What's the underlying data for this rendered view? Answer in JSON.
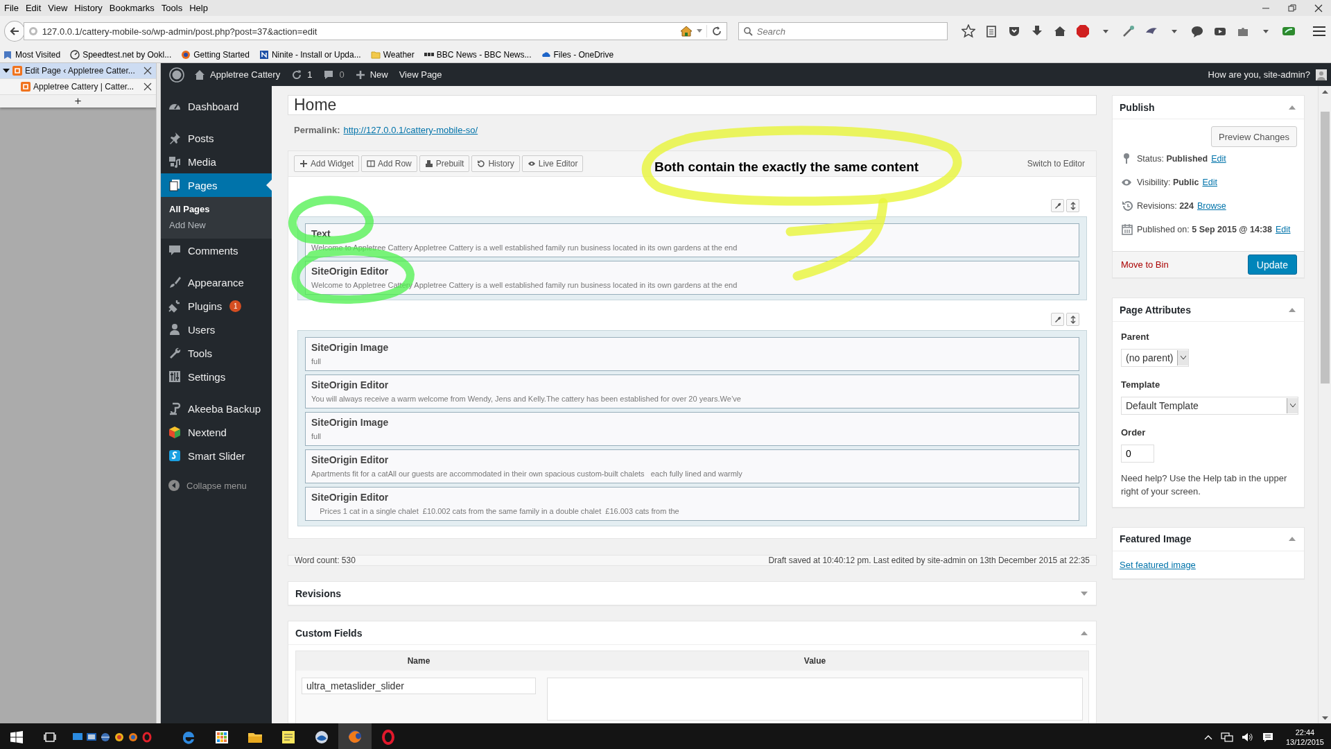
{
  "browser": {
    "menu": [
      "File",
      "Edit",
      "View",
      "History",
      "Bookmarks",
      "Tools",
      "Help"
    ],
    "url": "127.0.0.1/cattery-mobile-so/wp-admin/post.php?post=37&action=edit",
    "search": {
      "placeholder": "Search"
    },
    "bookmarks": [
      "Most Visited",
      "Speedtest.net by Ookl...",
      "Getting Started",
      "Ninite - Install or Upda...",
      "Weather",
      "BBC News - BBC News...",
      "Files - OneDrive"
    ]
  },
  "tab_tree": {
    "tabs": [
      {
        "title": "Edit Page ‹ Appletree Catter...",
        "selected": true,
        "expanded": true,
        "children": [
          {
            "title": "Appletree Cattery | Catter...",
            "selected": false
          }
        ]
      }
    ],
    "new_tab": "+"
  },
  "admin_bar": {
    "site": "Appletree Cattery",
    "updates": "1",
    "comments": "0",
    "new": "New",
    "view": "View Page",
    "greeting": "How are you, site-admin?"
  },
  "sidebar": {
    "groups": [
      [
        {
          "label": "Dashboard",
          "selected": false
        }
      ],
      [
        {
          "label": "Posts",
          "selected": false
        },
        {
          "label": "Media",
          "selected": false
        },
        {
          "label": "Pages",
          "selected": true,
          "children": [
            {
              "label": "All Pages",
              "selected": true
            },
            {
              "label": "Add New",
              "selected": false
            }
          ]
        },
        {
          "label": "Comments",
          "selected": false
        }
      ],
      [
        {
          "label": "Appearance",
          "selected": false
        },
        {
          "label": "Plugins",
          "selected": false,
          "badge": "1"
        },
        {
          "label": "Users",
          "selected": false
        },
        {
          "label": "Tools",
          "selected": false
        },
        {
          "label": "Settings",
          "selected": false
        }
      ],
      [
        {
          "label": "Akeeba Backup",
          "selected": false
        },
        {
          "label": "Nextend",
          "selected": false
        },
        {
          "label": "Smart Slider",
          "selected": false
        }
      ]
    ],
    "collapse": "Collapse menu"
  },
  "editor": {
    "title": "Home",
    "permalink": {
      "label": "Permalink:",
      "url": "http://127.0.0.1/cattery-mobile-so/"
    },
    "builder": {
      "tools": [
        "Add Widget",
        "Add Row",
        "Prebuilt",
        "History",
        "Live Editor"
      ],
      "switch": "Switch to Editor",
      "rows": [
        {
          "widgets": [
            {
              "title": "Text",
              "summary": "Welcome to Appletree Cattery Appletree Cattery is a well established family run business located in its own gardens at the end"
            },
            {
              "title": "SiteOrigin Editor",
              "summary": "Welcome to Appletree Cattery Appletree Cattery is a well established family run business located in its own gardens at the end"
            }
          ]
        },
        {
          "widgets": [
            {
              "title": "SiteOrigin Image",
              "summary": "full"
            },
            {
              "title": "SiteOrigin Editor",
              "summary": "You will always receive a warm welcome from Wendy, Jens and Kelly.The cattery has been established for over 20 years.We’ve"
            },
            {
              "title": "SiteOrigin Image",
              "summary": "full"
            },
            {
              "title": "SiteOrigin Editor",
              "summary": "Apartments fit for a catAll our guests are accommodated in their own spacious custom-built chalets   each fully lined and warmly"
            },
            {
              "title": "SiteOrigin Editor",
              "summary": "    Prices 1 cat in a single chalet  £10.002 cats from the same family in a double chalet  £16.003 cats from the"
            }
          ]
        }
      ]
    },
    "word_count": "Word count: 530",
    "draft_status": "Draft saved at 10:40:12 pm. Last edited by site-admin on 13th December 2015 at 22:35"
  },
  "annotation": {
    "text": "Both contain the exactly the same content"
  },
  "revisions": {
    "title": "Revisions",
    "expanded": false
  },
  "custom_fields": {
    "title": "Custom Fields",
    "expanded": true,
    "columns": [
      "Name",
      "Value"
    ],
    "name": "ultra_metaslider_slider"
  },
  "publish": {
    "title": "Publish",
    "expanded": true,
    "preview": "Preview Changes",
    "rows": [
      {
        "text": "Status: **Published**",
        "link": "Edit"
      },
      {
        "text": "Visibility: **Public**",
        "link": "Edit"
      },
      {
        "text": "Revisions: **224**",
        "link": "Browse"
      },
      {
        "text": "Published on: **5 Sep 2015 @ 14:38**",
        "link": "Edit"
      }
    ],
    "trash": "Move to Bin",
    "update": "Update"
  },
  "page_attributes": {
    "title": "Page Attributes",
    "expanded": true,
    "parent_label": "Parent",
    "parent": "(no parent)",
    "template_label": "Template",
    "template": "Default Template",
    "order_label": "Order",
    "order": "0",
    "help": "Need help? Use the Help tab in the upper right of your screen."
  },
  "featured_image": {
    "title": "Featured Image",
    "expanded": true,
    "link": "Set featured image"
  },
  "taskbar": {
    "time": "22:44",
    "date": "13/12/2015"
  }
}
